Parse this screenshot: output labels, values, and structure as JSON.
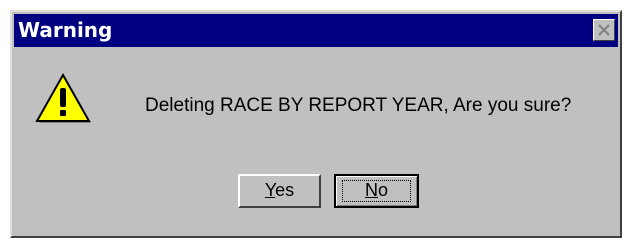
{
  "window": {
    "title": "Warning",
    "close_icon": "close-icon"
  },
  "dialog": {
    "icon": "warning-icon",
    "message": "Deleting RACE BY REPORT YEAR, Are you sure?"
  },
  "buttons": {
    "yes": {
      "mnemonic": "Y",
      "rest": "es"
    },
    "no": {
      "mnemonic": "N",
      "rest": "o"
    }
  },
  "colors": {
    "titlebar": "#000080",
    "face": "#c0c0c0",
    "warning_fill": "#ffff00"
  }
}
